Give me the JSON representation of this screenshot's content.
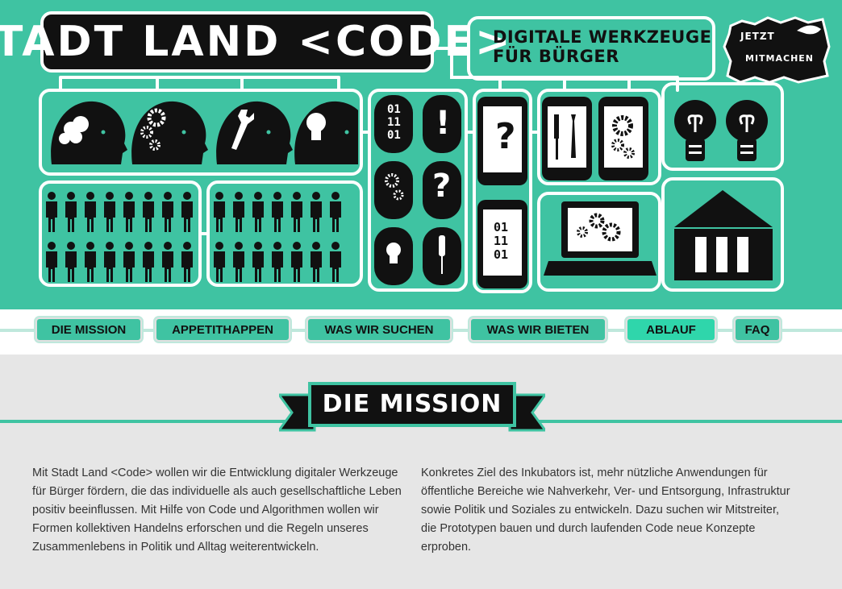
{
  "header": {
    "logo_text": "STADT LAND <CODE>",
    "tagline_line1": "DIGITALE WERKZEUGE",
    "tagline_line2": "FÜR BÜRGER",
    "badge_line1": "JETZT",
    "badge_line2": "MITMACHEN",
    "binary_a": [
      "01",
      "11",
      "01"
    ],
    "binary_b": [
      "01",
      "11",
      "01"
    ],
    "question_mark": "?",
    "exclamation_mark": "!"
  },
  "nav": {
    "items": [
      {
        "label": "DIE MISSION"
      },
      {
        "label": "APPETITHAPPEN"
      },
      {
        "label": "WAS WIR SUCHEN"
      },
      {
        "label": "WAS WIR BIETEN"
      },
      {
        "label": "ABLAUF"
      },
      {
        "label": "FAQ"
      }
    ],
    "active_index": 4
  },
  "section": {
    "title": "DIE MISSION",
    "paragraph_left": "Mit Stadt Land <Code> wollen wir die Entwicklung digitaler Werkzeuge für Bürger fördern, die das individuelle als auch gesellschaftliche Leben positiv beeinflussen. Mit Hilfe von Code und Algorithmen wollen wir Formen kollektiven Handelns erforschen und die Regeln unseres Zusammenlebens in Politik und Alltag weiterentwickeln.",
    "paragraph_right": "Konkretes Ziel des Inkubators ist, mehr nützliche Anwendungen für öffentliche Bereiche wie Nahverkehr, Ver- und Entsorgung, Infrastruktur sowie Politik und Soziales zu entwickeln. Dazu suchen wir Mitstreiter, die Prototypen bauen und durch laufenden Code neue Konzepte erproben."
  },
  "colors": {
    "accent": "#3fc3a2",
    "active_tab": "#2fd6ab",
    "dark": "#111111",
    "background": "#e6e6e6"
  }
}
